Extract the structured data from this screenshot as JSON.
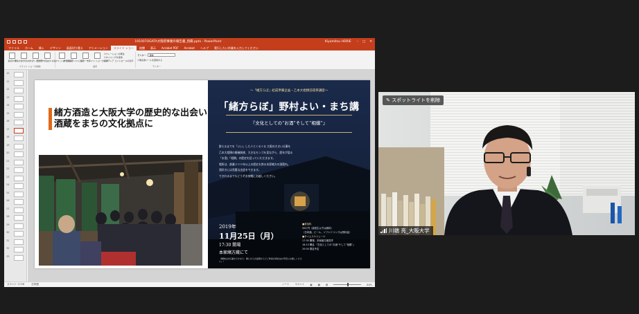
{
  "ppt": {
    "title": "191007OGATA大阪府事業の報告書_別冊.pptx  -  PowerPoint",
    "user": "Kiyomitsu HORIE",
    "tabs": [
      "ファイル",
      "ホーム",
      "挿入",
      "デザイン",
      "画面切り替え",
      "アニメーション",
      "スライド ショー",
      "校閲",
      "表示",
      "Acrobat PDF",
      "Acrobat",
      "ヘルプ"
    ],
    "active_tab": "スライド ショー",
    "tell_me": "実行したい作業を入力してください",
    "ribbon": {
      "group1": {
        "label": "スライド ショーの開始",
        "buttons": [
          "最初から",
          "現在のスライドから",
          "オンライン プレゼンテーション",
          "目的別スライド ショー"
        ]
      },
      "group2": {
        "label": "設定",
        "buttons": [
          "スライド ショーの設定",
          "非表示スライドに設定",
          "リハーサル",
          "スライド ショーの記録"
        ]
      },
      "checks": [
        "ナレーションの再生",
        "タイミングを使用",
        "メディア コントロールの表示"
      ],
      "group3": {
        "label": "モニター",
        "monitor_label": "モニター:",
        "monitor_value": "自動",
        "presenter": "発表者ツールを使用する"
      }
    },
    "slide_numbers": [
      "10",
      "11",
      "12",
      "13",
      "14",
      "15",
      "16",
      "17",
      "18",
      "19",
      "20",
      "21",
      "22",
      "23",
      "24",
      "25",
      "26",
      "27",
      "28",
      "29",
      "30",
      "31",
      "32",
      "33"
    ],
    "status": {
      "slide": "スライド 17/36",
      "lang": "日本語",
      "notes": "ノート",
      "comments": "コメント",
      "zoom": "84%"
    }
  },
  "slide": {
    "title_line1": "緒方酒造と大阪大学の歴史的な出会い",
    "title_line2": "酒蔵をまちの文化拠点に",
    "poster": {
      "subtitle": "～「緒方らぼ」結成準備企画・乙本大相撲前夜祭講座～",
      "title": "「緒方らぼ」野村よい・まち講",
      "subtitle2": "『文化としての“お酒”そして“相撲”』",
      "body": [
        "酔えるまでを「いい」した人とくるぐる 大阪の大きい仕事を",
        "乙本大相撲の開催前夜、大きなモンゴを見ながら、歴年が語る",
        "「お酒」「相撲」の歴史を話っていただきます。",
        "場所は、創業２００年以上の歴史を誇る本家緒方の酒蔵内。",
        "酒好きには貴重な出会をできます。",
        "できれるまでもどうぞお気軽にお越しください。"
      ],
      "year": "2019年",
      "day": "11月25日（月）",
      "time": "17:30 開場",
      "place": "本家緒方蔵にて",
      "fine": "（乗物はお気兼ねでかなり、乗にからの遠隔からでご参加の場合はお早目にお越しください。）",
      "info": [
        "■参加料",
        "500 円（高校生以下は無料）",
        "（日本酒、ビール、ソフトドリンクは別料金）",
        "■タイムスケジュール",
        "17:30  開場、本家緒方蔵見学",
        "18:15  開会  「文化としての“お酒”そして“相撲”」",
        "20:00  閉会予定"
      ]
    }
  },
  "video": {
    "spotlight": "スポットライトを削除",
    "name": "川端 亮_大阪大学"
  },
  "colors": {
    "ppt_accent": "#c43e1c",
    "title_bar_accent": "#e06a1b",
    "poster_bg": "#15223d"
  }
}
